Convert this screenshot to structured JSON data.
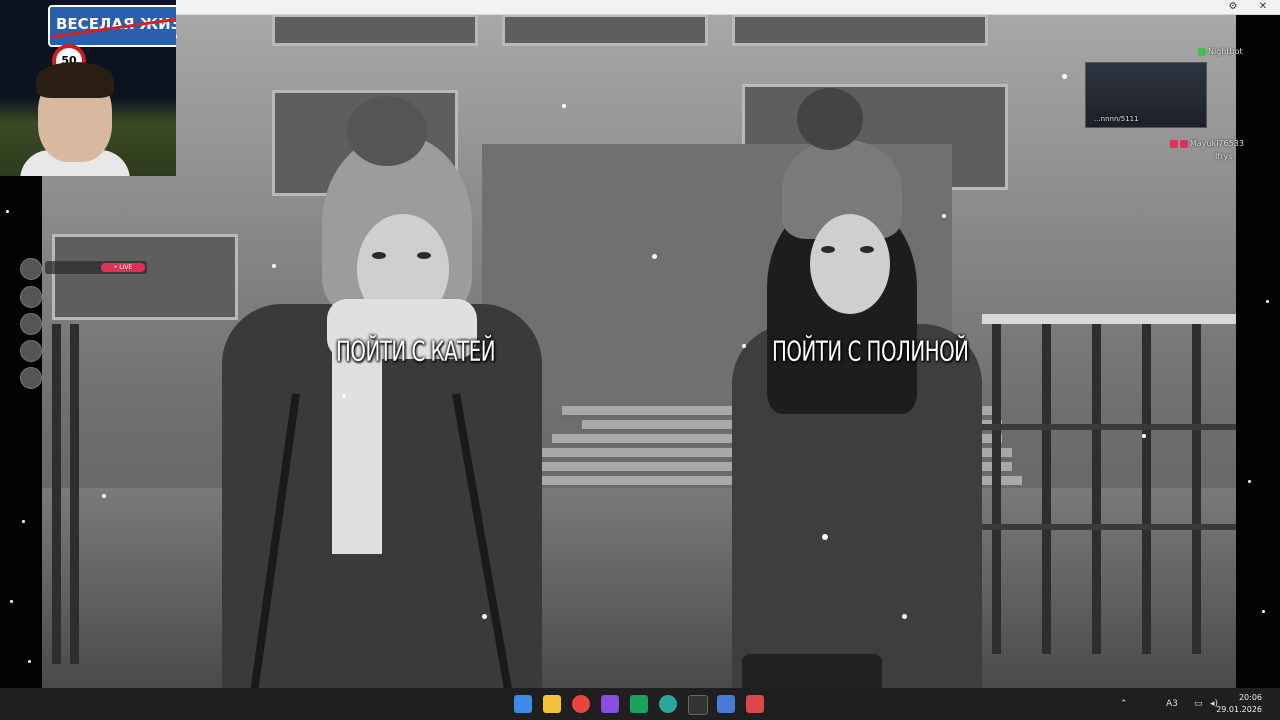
{
  "webcam": {
    "road_sign_text": "ВЕСЕЛАЯ ЖИЗ",
    "speed_sign_text": "50"
  },
  "game": {
    "choices": [
      {
        "label": "ПОЙТИ С КАТЕЙ"
      },
      {
        "label": "ПОЙТИ С ПОЛИНОЙ"
      }
    ]
  },
  "chat": {
    "lines": [
      {
        "user": "Nightbot"
      },
      {
        "user": "Mayuki76533"
      },
      {
        "user": "Ifrys"
      }
    ],
    "thumb_caption": "...nnnn/5111"
  },
  "stream_widget": {
    "tag": "• LIVE"
  },
  "taskbar": {
    "icons": [
      {
        "name": "windows-start-icon",
        "color": "#3c8be6"
      },
      {
        "name": "file-explorer-icon",
        "color": "#f3c33b"
      },
      {
        "name": "chrome-icon",
        "color": "#e8453c"
      },
      {
        "name": "app-purple-icon",
        "color": "#8b4ee0"
      },
      {
        "name": "app-green-icon",
        "color": "#1aa260"
      },
      {
        "name": "app-teal-icon",
        "color": "#2aa8a0"
      },
      {
        "name": "app-dark-icon",
        "color": "#333333"
      },
      {
        "name": "app-blue-icon",
        "color": "#4a7ad8"
      },
      {
        "name": "app-red-icon",
        "color": "#d94848"
      }
    ],
    "lang": "A3",
    "time": "20:06",
    "date": "29.01.2026"
  },
  "colors": {
    "taskbar_bg": "#1f1f1f",
    "sign_blue": "#2a5fb0",
    "live_tag": "#e0305a"
  }
}
